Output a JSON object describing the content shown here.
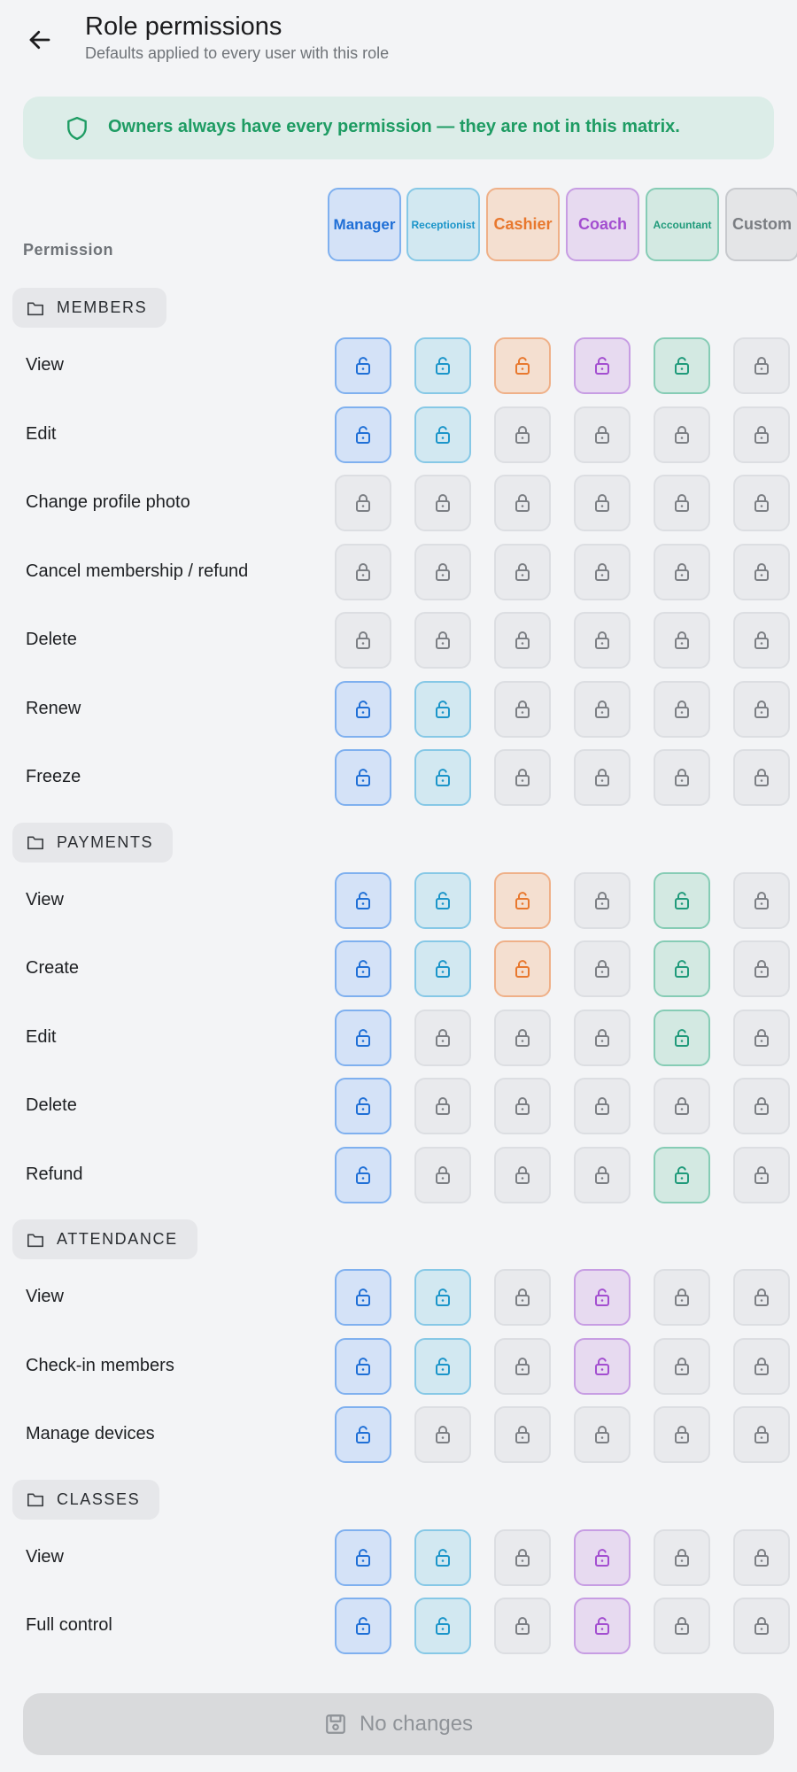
{
  "header": {
    "title": "Role permissions",
    "subtitle": "Defaults applied to every user with this role"
  },
  "notice": {
    "text": "Owners always have every permission — they are not in this matrix.",
    "color": "#1e9c63"
  },
  "matrix": {
    "permission_header": "Permission",
    "roles": [
      {
        "label": "Manager",
        "color": "#1f6fd6",
        "bg": "#d4e2f7",
        "border": "#7fb0ef",
        "font_size": 17
      },
      {
        "label": "Receptionist",
        "color": "#1b95c9",
        "bg": "#d2e8f1",
        "border": "#86c8e6",
        "font_size": 12
      },
      {
        "label": "Cashier",
        "color": "#e8782e",
        "bg": "#f4dfd0",
        "border": "#efb088",
        "font_size": 18
      },
      {
        "label": "Coach",
        "color": "#a34ed0",
        "bg": "#e7daf0",
        "border": "#c79de3",
        "font_size": 18
      },
      {
        "label": "Accountant",
        "color": "#1f9a7a",
        "bg": "#d3e9e2",
        "border": "#86ccb5",
        "font_size": 12
      },
      {
        "label": "Custom",
        "color": "#7a7d82",
        "bg": "#e4e5e7",
        "border": "#c7c9cd",
        "font_size": 18
      }
    ],
    "sections": [
      {
        "name": "MEMBERS",
        "rows": [
          {
            "label": "View",
            "grants": [
              true,
              true,
              true,
              true,
              true,
              false
            ]
          },
          {
            "label": "Edit",
            "grants": [
              true,
              true,
              false,
              false,
              false,
              false
            ]
          },
          {
            "label": "Change profile photo",
            "grants": [
              false,
              false,
              false,
              false,
              false,
              false
            ]
          },
          {
            "label": "Cancel membership / refund",
            "grants": [
              false,
              false,
              false,
              false,
              false,
              false
            ]
          },
          {
            "label": "Delete",
            "grants": [
              false,
              false,
              false,
              false,
              false,
              false
            ]
          },
          {
            "label": "Renew",
            "grants": [
              true,
              true,
              false,
              false,
              false,
              false
            ]
          },
          {
            "label": "Freeze",
            "grants": [
              true,
              true,
              false,
              false,
              false,
              false
            ]
          }
        ]
      },
      {
        "name": "PAYMENTS",
        "rows": [
          {
            "label": "View",
            "grants": [
              true,
              true,
              true,
              false,
              true,
              false
            ]
          },
          {
            "label": "Create",
            "grants": [
              true,
              true,
              true,
              false,
              true,
              false
            ]
          },
          {
            "label": "Edit",
            "grants": [
              true,
              false,
              false,
              false,
              true,
              false
            ]
          },
          {
            "label": "Delete",
            "grants": [
              true,
              false,
              false,
              false,
              false,
              false
            ]
          },
          {
            "label": "Refund",
            "grants": [
              true,
              false,
              false,
              false,
              true,
              false
            ]
          }
        ]
      },
      {
        "name": "ATTENDANCE",
        "rows": [
          {
            "label": "View",
            "grants": [
              true,
              true,
              false,
              true,
              false,
              false
            ]
          },
          {
            "label": "Check-in members",
            "grants": [
              true,
              true,
              false,
              true,
              false,
              false
            ]
          },
          {
            "label": "Manage devices",
            "grants": [
              true,
              false,
              false,
              false,
              false,
              false
            ]
          }
        ]
      },
      {
        "name": "CLASSES",
        "rows": [
          {
            "label": "View",
            "grants": [
              true,
              true,
              false,
              true,
              false,
              false
            ]
          },
          {
            "label": "Full control",
            "grants": [
              true,
              true,
              false,
              true,
              false,
              false
            ]
          }
        ]
      }
    ]
  },
  "save_bar": {
    "label": "No changes"
  }
}
